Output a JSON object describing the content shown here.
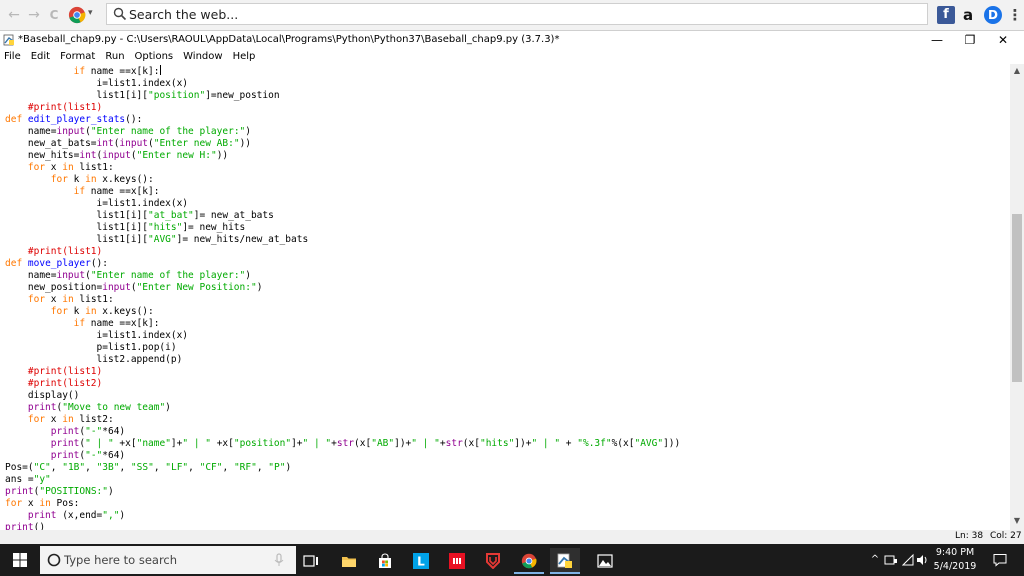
{
  "browser": {
    "search_placeholder": "Search the web...",
    "back_glyph": "←",
    "forward_glyph": "→",
    "reload_glyph": "C",
    "ext_f": "f",
    "ext_a": "a",
    "ext_d": "D",
    "menu_glyph": "⋮"
  },
  "window": {
    "title": "*Baseball_chap9.py - C:\\Users\\RAOUL\\AppData\\Local\\Programs\\Python\\Python37\\Baseball_chap9.py (3.7.3)*",
    "minimize": "—",
    "maximize": "❐",
    "close": "✕"
  },
  "menu": {
    "items": [
      "File",
      "Edit",
      "Format",
      "Run",
      "Options",
      "Window",
      "Help"
    ]
  },
  "code_lines": [
    [
      [
        "k",
        "            if"
      ],
      [
        "n",
        " name ==x[k]:"
      ]
    ],
    [
      [
        "n",
        "                i=list1.index(x)"
      ]
    ],
    [
      [
        "n",
        "                list1[i]["
      ],
      [
        "s",
        "\"position\""
      ],
      [
        "n",
        "]=new_postion"
      ]
    ],
    [
      [
        "c",
        "    #print(list1)"
      ]
    ],
    [
      [
        "k",
        "def"
      ],
      [
        "n",
        " "
      ],
      [
        "d",
        "edit_player_stats"
      ],
      [
        "n",
        "():"
      ]
    ],
    [
      [
        "n",
        "    name="
      ],
      [
        "b",
        "input"
      ],
      [
        "n",
        "("
      ],
      [
        "s",
        "\"Enter name of the player:\""
      ],
      [
        "n",
        ")"
      ]
    ],
    [
      [
        "n",
        "    new_at_bats="
      ],
      [
        "b",
        "int"
      ],
      [
        "n",
        "("
      ],
      [
        "b",
        "input"
      ],
      [
        "n",
        "("
      ],
      [
        "s",
        "\"Enter new AB:\""
      ],
      [
        "n",
        "))"
      ]
    ],
    [
      [
        "n",
        "    new_hits="
      ],
      [
        "b",
        "int"
      ],
      [
        "n",
        "("
      ],
      [
        "b",
        "input"
      ],
      [
        "n",
        "("
      ],
      [
        "s",
        "\"Enter new H:\""
      ],
      [
        "n",
        "))"
      ]
    ],
    [
      [
        "k",
        "    for"
      ],
      [
        "n",
        " x "
      ],
      [
        "k",
        "in"
      ],
      [
        "n",
        " list1:"
      ]
    ],
    [
      [
        "k",
        "        for"
      ],
      [
        "n",
        " k "
      ],
      [
        "k",
        "in"
      ],
      [
        "n",
        " x.keys():"
      ]
    ],
    [
      [
        "k",
        "            if"
      ],
      [
        "n",
        " name ==x[k]:"
      ]
    ],
    [
      [
        "n",
        "                i=list1.index(x)"
      ]
    ],
    [
      [
        "n",
        "                list1[i]["
      ],
      [
        "s",
        "\"at_bat\""
      ],
      [
        "n",
        "]= new_at_bats"
      ]
    ],
    [
      [
        "n",
        "                list1[i]["
      ],
      [
        "s",
        "\"hits\""
      ],
      [
        "n",
        "]= new_hits"
      ]
    ],
    [
      [
        "n",
        "                list1[i]["
      ],
      [
        "s",
        "\"AVG\""
      ],
      [
        "n",
        "]= new_hits/new_at_bats"
      ]
    ],
    [
      [
        "c",
        "    #print(list1)"
      ]
    ],
    [
      [
        "k",
        "def"
      ],
      [
        "n",
        " "
      ],
      [
        "d",
        "move_player"
      ],
      [
        "n",
        "():"
      ]
    ],
    [
      [
        "n",
        "    name="
      ],
      [
        "b",
        "input"
      ],
      [
        "n",
        "("
      ],
      [
        "s",
        "\"Enter name of the player:\""
      ],
      [
        "n",
        ")"
      ]
    ],
    [
      [
        "n",
        "    new_position="
      ],
      [
        "b",
        "input"
      ],
      [
        "n",
        "("
      ],
      [
        "s",
        "\"Enter New Position:\""
      ],
      [
        "n",
        ")"
      ]
    ],
    [
      [
        "k",
        "    for"
      ],
      [
        "n",
        " x "
      ],
      [
        "k",
        "in"
      ],
      [
        "n",
        " list1:"
      ]
    ],
    [
      [
        "k",
        "        for"
      ],
      [
        "n",
        " k "
      ],
      [
        "k",
        "in"
      ],
      [
        "n",
        " x.keys():"
      ]
    ],
    [
      [
        "k",
        "            if"
      ],
      [
        "n",
        " name ==x[k]:"
      ]
    ],
    [
      [
        "n",
        "                i=list1.index(x)"
      ]
    ],
    [
      [
        "n",
        "                p=list1.pop(i)"
      ]
    ],
    [
      [
        "n",
        "                list2.append(p)"
      ]
    ],
    [
      [
        "c",
        "    #print(list1)"
      ]
    ],
    [
      [
        "c",
        "    #print(list2)"
      ]
    ],
    [
      [
        "n",
        "    display()"
      ]
    ],
    [
      [
        "b",
        "    print"
      ],
      [
        "n",
        "("
      ],
      [
        "s",
        "\"Move to new team\""
      ],
      [
        "n",
        ")"
      ]
    ],
    [
      [
        "k",
        "    for"
      ],
      [
        "n",
        " x "
      ],
      [
        "k",
        "in"
      ],
      [
        "n",
        " list2:"
      ]
    ],
    [
      [
        "b",
        "        print"
      ],
      [
        "n",
        "("
      ],
      [
        "s",
        "\"-\""
      ],
      [
        "n",
        "*64)"
      ]
    ],
    [
      [
        "b",
        "        print"
      ],
      [
        "n",
        "("
      ],
      [
        "s",
        "\" | \""
      ],
      [
        "n",
        " +x["
      ],
      [
        "s",
        "\"name\""
      ],
      [
        "n",
        "]+"
      ],
      [
        "s",
        "\" | \""
      ],
      [
        "n",
        " +x["
      ],
      [
        "s",
        "\"position\""
      ],
      [
        "n",
        "]+"
      ],
      [
        "s",
        "\" | \""
      ],
      [
        "n",
        "+"
      ],
      [
        "b",
        "str"
      ],
      [
        "n",
        "(x["
      ],
      [
        "s",
        "\"AB\""
      ],
      [
        "n",
        "])+"
      ],
      [
        "s",
        "\" | \""
      ],
      [
        "n",
        "+"
      ],
      [
        "b",
        "str"
      ],
      [
        "n",
        "(x["
      ],
      [
        "s",
        "\"hits\""
      ],
      [
        "n",
        "])+"
      ],
      [
        "s",
        "\" | \""
      ],
      [
        "n",
        " + "
      ],
      [
        "s",
        "\"%.3f\""
      ],
      [
        "n",
        "%(x["
      ],
      [
        "s",
        "\"AVG\""
      ],
      [
        "n",
        "]))"
      ]
    ],
    [
      [
        "b",
        "        print"
      ],
      [
        "n",
        "("
      ],
      [
        "s",
        "\"-\""
      ],
      [
        "n",
        "*64)"
      ]
    ],
    [
      [
        "n",
        "Pos=("
      ],
      [
        "s",
        "\"C\""
      ],
      [
        "n",
        ", "
      ],
      [
        "s",
        "\"1B\""
      ],
      [
        "n",
        ", "
      ],
      [
        "s",
        "\"3B\""
      ],
      [
        "n",
        ", "
      ],
      [
        "s",
        "\"SS\""
      ],
      [
        "n",
        ", "
      ],
      [
        "s",
        "\"LF\""
      ],
      [
        "n",
        ", "
      ],
      [
        "s",
        "\"CF\""
      ],
      [
        "n",
        ", "
      ],
      [
        "s",
        "\"RF\""
      ],
      [
        "n",
        ", "
      ],
      [
        "s",
        "\"P\""
      ],
      [
        "n",
        ")"
      ]
    ],
    [
      [
        "n",
        "ans ="
      ],
      [
        "s",
        "\"y\""
      ]
    ],
    [
      [
        "b",
        "print"
      ],
      [
        "n",
        "("
      ],
      [
        "s",
        "\"POSITIONS:\""
      ],
      [
        "n",
        ")"
      ]
    ],
    [
      [
        "k",
        "for"
      ],
      [
        "n",
        " x "
      ],
      [
        "k",
        "in"
      ],
      [
        "n",
        " Pos:"
      ]
    ],
    [
      [
        "b",
        "    print"
      ],
      [
        "n",
        " (x,end="
      ],
      [
        "s",
        "\",\""
      ],
      [
        "n",
        ")"
      ]
    ],
    [
      [
        "b",
        "print"
      ],
      [
        "n",
        "()"
      ]
    ]
  ],
  "status": {
    "line": "Ln: 38",
    "col": "Col: 27"
  },
  "taskbar": {
    "search_placeholder": "Type here to search",
    "time": "9:40 PM",
    "date": "5/4/2019",
    "app_l_label": "L"
  },
  "colors": {
    "keyword": "#ff7700",
    "string": "#00aa00",
    "comment": "#dd0000",
    "builtin": "#900090",
    "defname": "#0000ff",
    "taskbar": "#1b1b1b"
  }
}
